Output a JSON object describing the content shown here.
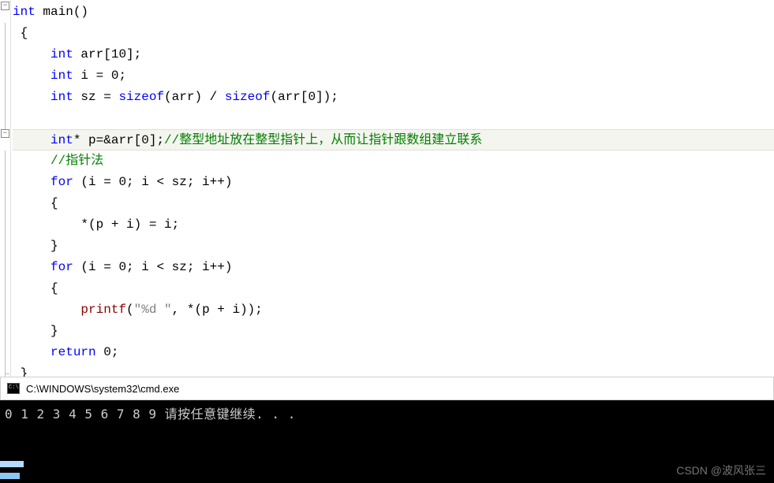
{
  "code": {
    "lines": [
      {
        "indent": "",
        "tokens": [
          {
            "t": "kw",
            "v": "int"
          },
          {
            "t": "plain",
            "v": " main()"
          }
        ]
      },
      {
        "indent": " ",
        "tokens": [
          {
            "t": "plain",
            "v": "{"
          }
        ]
      },
      {
        "indent": "     ",
        "tokens": [
          {
            "t": "kw",
            "v": "int"
          },
          {
            "t": "plain",
            "v": " arr[10];"
          }
        ]
      },
      {
        "indent": "     ",
        "tokens": [
          {
            "t": "kw",
            "v": "int"
          },
          {
            "t": "plain",
            "v": " i = 0;"
          }
        ]
      },
      {
        "indent": "     ",
        "tokens": [
          {
            "t": "kw",
            "v": "int"
          },
          {
            "t": "plain",
            "v": " sz = "
          },
          {
            "t": "kw",
            "v": "sizeof"
          },
          {
            "t": "plain",
            "v": "(arr) / "
          },
          {
            "t": "kw",
            "v": "sizeof"
          },
          {
            "t": "plain",
            "v": "(arr[0]);"
          }
        ]
      },
      {
        "indent": "",
        "tokens": []
      },
      {
        "indent": "     ",
        "highlighted": true,
        "tokens": [
          {
            "t": "kw",
            "v": "int"
          },
          {
            "t": "plain",
            "v": "* p=&arr[0];"
          },
          {
            "t": "cmt",
            "v": "//整型地址放在整型指针上，从而让指针跟数组建立联系"
          }
        ]
      },
      {
        "indent": "     ",
        "tokens": [
          {
            "t": "cmt",
            "v": "//指针法"
          }
        ]
      },
      {
        "indent": "     ",
        "tokens": [
          {
            "t": "kw",
            "v": "for"
          },
          {
            "t": "plain",
            "v": " (i = 0; i < sz; i++)"
          }
        ]
      },
      {
        "indent": "     ",
        "tokens": [
          {
            "t": "plain",
            "v": "{"
          }
        ]
      },
      {
        "indent": "         ",
        "tokens": [
          {
            "t": "plain",
            "v": "*(p + i) = i;"
          }
        ]
      },
      {
        "indent": "     ",
        "tokens": [
          {
            "t": "plain",
            "v": "}"
          }
        ]
      },
      {
        "indent": "     ",
        "tokens": [
          {
            "t": "kw",
            "v": "for"
          },
          {
            "t": "plain",
            "v": " (i = 0; i < sz; i++)"
          }
        ]
      },
      {
        "indent": "     ",
        "tokens": [
          {
            "t": "plain",
            "v": "{"
          }
        ]
      },
      {
        "indent": "         ",
        "tokens": [
          {
            "t": "fn",
            "v": "printf"
          },
          {
            "t": "plain",
            "v": "("
          },
          {
            "t": "str",
            "v": "\"%d \""
          },
          {
            "t": "plain",
            "v": ", *(p + i));"
          }
        ]
      },
      {
        "indent": "     ",
        "tokens": [
          {
            "t": "plain",
            "v": "}"
          }
        ]
      },
      {
        "indent": "     ",
        "tokens": [
          {
            "t": "kw",
            "v": "return"
          },
          {
            "t": "plain",
            "v": " 0;"
          }
        ]
      },
      {
        "indent": " ",
        "tokens": [
          {
            "t": "plain",
            "v": "}"
          }
        ]
      }
    ],
    "fold": {
      "box1": "−",
      "box2": "−"
    }
  },
  "console": {
    "title": "C:\\WINDOWS\\system32\\cmd.exe",
    "output": "0 1 2 3 4 5 6 7 8 9 请按任意键继续. . ."
  },
  "watermark": "CSDN @波风张三"
}
